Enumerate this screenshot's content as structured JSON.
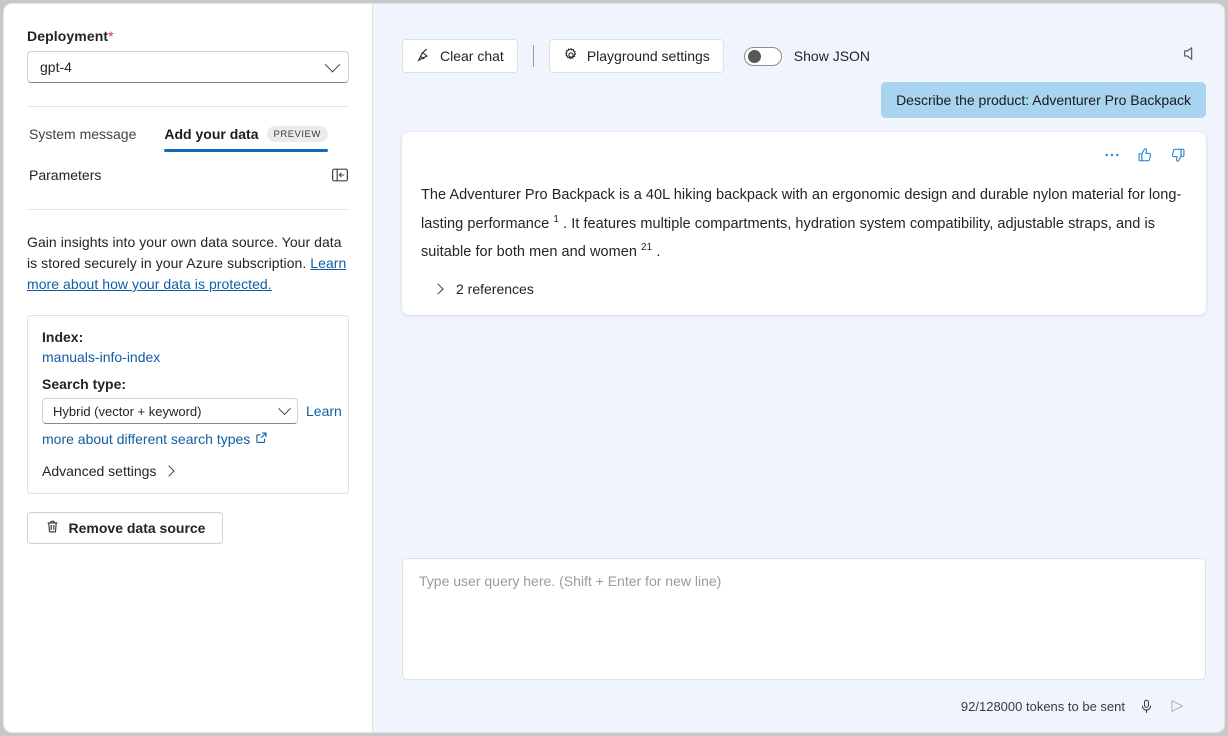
{
  "left": {
    "deployment": {
      "label": "Deployment",
      "required_marker": "*",
      "value": "gpt-4"
    },
    "tabs": [
      {
        "label": "System message",
        "active": false
      },
      {
        "label": "Add your data",
        "active": true,
        "badge": "PREVIEW"
      }
    ],
    "parameters_label": "Parameters",
    "blurb": {
      "text": "Gain insights into your own data source. Your data is stored securely in your Azure subscription. ",
      "link": "Learn more about how your data is protected."
    },
    "data_source": {
      "index_label": "Index:",
      "index_value": "manuals-info-index",
      "search_type_label": "Search type:",
      "search_type_value": "Hybrid (vector + keyword)",
      "learn_link_part1": "Learn",
      "learn_link_part2": "more about different search types",
      "advanced_settings": "Advanced settings"
    },
    "remove_button": "Remove data source"
  },
  "toolbar": {
    "clear_chat": "Clear chat",
    "playground_settings": "Playground settings",
    "show_json": "Show JSON",
    "show_json_on": false
  },
  "chat": {
    "user_message": "Describe the product: Adventurer Pro Backpack",
    "assistant": {
      "segments": [
        {
          "type": "text",
          "value": "The Adventurer Pro Backpack is a 40L hiking backpack with an ergonomic design and durable nylon material for long-lasting performance "
        },
        {
          "type": "citation",
          "value": "1"
        },
        {
          "type": "text",
          "value": " . It features multiple compartments, hydration system compatibility, adjustable straps, and is suitable for both men and women "
        },
        {
          "type": "citation",
          "value": "2"
        },
        {
          "type": "citation",
          "value": "1"
        },
        {
          "type": "text",
          "value": " ."
        }
      ],
      "references_label": "2 references"
    }
  },
  "composer": {
    "placeholder": "Type user query here. (Shift + Enter for new line)",
    "value": "",
    "tokens": "92/128000 tokens to be sent"
  },
  "colors": {
    "accent": "#1668c1",
    "link": "#115ea3",
    "user_bubble": "#a8d4ef",
    "chat_bg": "#f0f4fc",
    "required": "#c4314b",
    "action_icon": "#2b88d8"
  }
}
